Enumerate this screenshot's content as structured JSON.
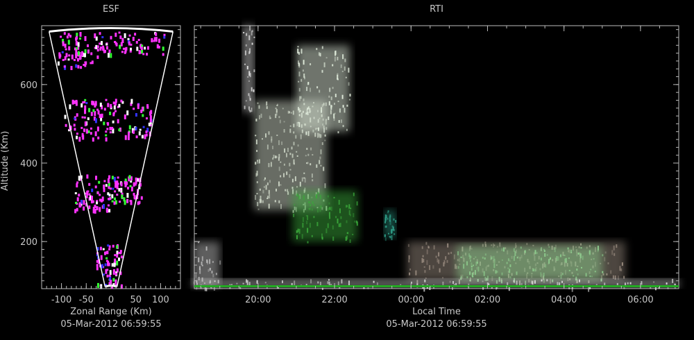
{
  "chart_data": [
    {
      "type": "scatter",
      "title": "ESF",
      "xlabel": "Zonal Range (Km)",
      "ylabel": "Altitude (Km)",
      "timestamp": "05-Mar-2012 06:59:55",
      "xlim": [
        -140,
        140
      ],
      "ylim": [
        80,
        750
      ],
      "x_ticks": [
        -100,
        -50,
        0,
        50,
        100
      ],
      "x_tick_labels": [
        "-100",
        "-50",
        "0",
        "50",
        "100"
      ],
      "y_ticks": [
        200,
        400,
        600
      ],
      "y_tick_labels": [
        "200",
        "400",
        "600"
      ],
      "grid": false,
      "fan_edges_km": {
        "bottom_halfwidth": 12,
        "top_halfwidth": 115,
        "bottom_alt": 85,
        "top_alt": 735
      },
      "echo_clusters": [
        {
          "x_range": [
            -110,
            -25
          ],
          "alt_range": [
            645,
            735
          ],
          "color": "#ff33ff"
        },
        {
          "x_range": [
            -25,
            110
          ],
          "alt_range": [
            680,
            735
          ],
          "color": "#ff33ff"
        },
        {
          "x_range": [
            -95,
            -10
          ],
          "alt_range": [
            465,
            565
          ],
          "color": "#ff33ff"
        },
        {
          "x_range": [
            -10,
            80
          ],
          "alt_range": [
            470,
            570
          ],
          "color": "#ff33ff"
        },
        {
          "x_range": [
            -75,
            -5
          ],
          "alt_range": [
            280,
            375
          ],
          "color": "#ff33ff"
        },
        {
          "x_range": [
            -5,
            60
          ],
          "alt_range": [
            300,
            370
          ],
          "color": "#ff33ff"
        },
        {
          "x_range": [
            -30,
            20
          ],
          "alt_range": [
            90,
            195
          ],
          "color": "#ff33ff"
        }
      ]
    },
    {
      "type": "heatmap",
      "title": "RTI",
      "xlabel": "Local Time",
      "timestamp": "05-Mar-2012 06:59:55",
      "xlim": [
        "18:20",
        "07:00"
      ],
      "ylim": [
        80,
        750
      ],
      "x_tick_labels": [
        "20:00",
        "22:00",
        "00:00",
        "02:00",
        "04:00",
        "06:00"
      ],
      "x_ticks_hours": [
        20,
        22,
        24,
        26,
        28,
        30
      ],
      "y_ticks": [
        200,
        400,
        600
      ],
      "y_lim": [
        80,
        750
      ],
      "grid": false,
      "echo_regions": [
        {
          "t_range": [
            18.3,
            19.0
          ],
          "alt_range": [
            85,
            200
          ],
          "color": "#bbbbbb"
        },
        {
          "t_range": [
            19.6,
            19.9
          ],
          "alt_range": [
            530,
            750
          ],
          "color": "#dddddd"
        },
        {
          "t_range": [
            19.9,
            21.8
          ],
          "alt_range": [
            280,
            560
          ],
          "color": "#cfd8c8"
        },
        {
          "t_range": [
            21.0,
            22.4
          ],
          "alt_range": [
            480,
            700
          ],
          "color": "#dde8d8"
        },
        {
          "t_range": [
            20.9,
            22.6
          ],
          "alt_range": [
            200,
            330
          ],
          "color": "#3aa63a"
        },
        {
          "t_range": [
            23.3,
            23.6
          ],
          "alt_range": [
            210,
            280
          ],
          "color": "#2fa08a"
        },
        {
          "t_range": [
            23.9,
            29.6
          ],
          "alt_range": [
            100,
            200
          ],
          "color": "#9a8c80"
        },
        {
          "t_range": [
            25.2,
            29.0
          ],
          "alt_range": [
            100,
            190
          ],
          "color": "#8fcf8f"
        },
        {
          "t_range": [
            18.3,
            31.0
          ],
          "alt_range": [
            82,
            105
          ],
          "color": "#d8d8d8"
        }
      ]
    }
  ]
}
